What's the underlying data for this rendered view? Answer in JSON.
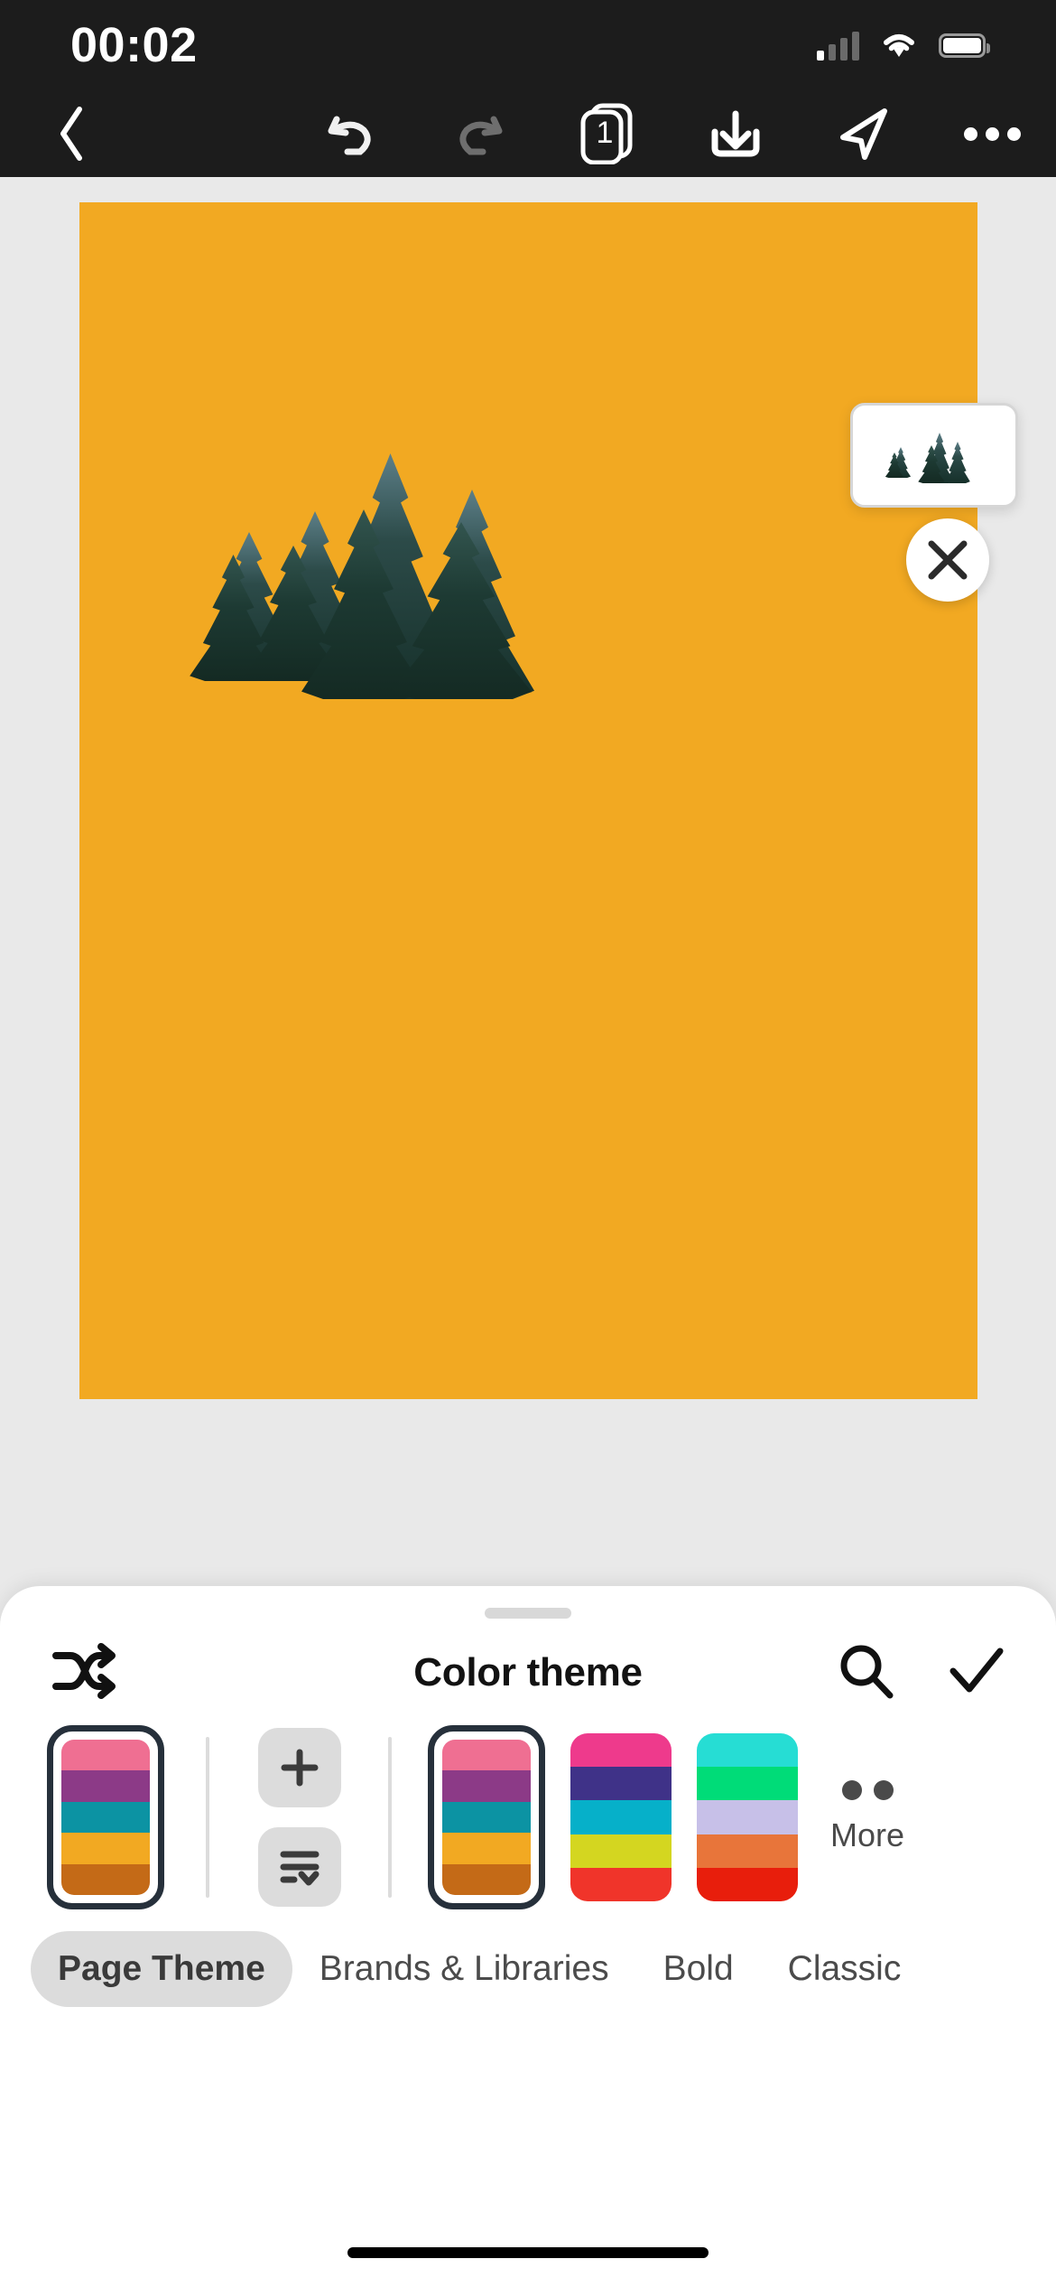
{
  "status_bar": {
    "time": "00:02",
    "icons": [
      "cellular-signal-icon",
      "wifi-icon",
      "battery-icon"
    ]
  },
  "toolbar": {
    "back_label": "",
    "items": [
      {
        "name": "back-button",
        "icon": "chevron-left-icon"
      },
      {
        "name": "undo-button",
        "icon": "undo-icon",
        "state": "enabled"
      },
      {
        "name": "redo-button",
        "icon": "redo-icon",
        "state": "disabled"
      },
      {
        "name": "pages-button",
        "icon": "pages-icon",
        "badge": "1"
      },
      {
        "name": "download-button",
        "icon": "download-icon"
      },
      {
        "name": "share-button",
        "icon": "send-icon"
      },
      {
        "name": "more-button",
        "icon": "ellipsis-icon"
      }
    ],
    "page_count_badge": "1"
  },
  "canvas": {
    "background_color": "#f2a922",
    "element_name": "trees-cutout-image",
    "thumbnail": {
      "name": "selected-element-thumbnail",
      "alt": "trees cutout"
    },
    "close_label": "×"
  },
  "sheet": {
    "title": "Color theme",
    "shuffle_icon": "shuffle-icon",
    "search_icon": "search-icon",
    "confirm_icon": "check-icon",
    "add_label": "+",
    "palettes": [
      {
        "name": "current-page-theme",
        "selected": true,
        "colors": [
          "#ef6f92",
          "#8c3a87",
          "#0c93a3",
          "#f2a922",
          "#c46a17"
        ]
      },
      {
        "name": "page-theme-duplicate",
        "selected": true,
        "colors": [
          "#ef6f92",
          "#8c3a87",
          "#0c93a3",
          "#f2a922",
          "#c46a17"
        ]
      },
      {
        "name": "palette-bold",
        "selected": false,
        "colors": [
          "#ee3a8c",
          "#3f3288",
          "#06b0c9",
          "#d4d620",
          "#f0342a"
        ]
      },
      {
        "name": "palette-classic",
        "selected": false,
        "colors": [
          "#26ddd4",
          "#00dc78",
          "#c7c0e8",
          "#e8753a",
          "#e81e0c"
        ]
      }
    ],
    "more": {
      "label": "More",
      "icon": "more-dots-icon"
    },
    "tabs": [
      {
        "label": "Page Theme",
        "active": true
      },
      {
        "label": "Brands & Libraries",
        "active": false
      },
      {
        "label": "Bold",
        "active": false
      },
      {
        "label": "Classic",
        "active": false
      }
    ]
  },
  "colors": {
    "canvas_amber": "#f2a922",
    "chrome_dark": "#1c1c1c",
    "workspace_gray": "#e9e9e9",
    "selected_border": "#26303b",
    "tab_active_bg": "#dcdcdc"
  }
}
